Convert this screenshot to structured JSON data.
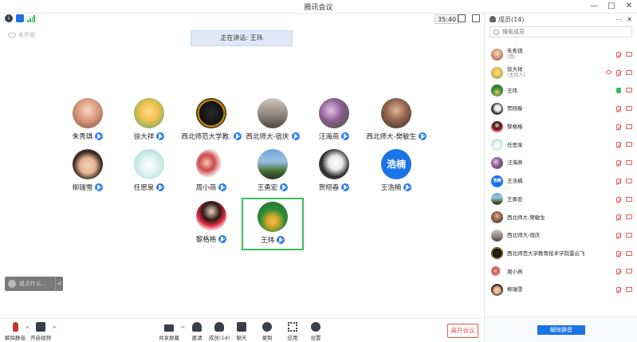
{
  "window": {
    "title": "腾讯会议",
    "controls": [
      "—",
      "□",
      "✕"
    ]
  },
  "info": {
    "timer": "35:40"
  },
  "stage": {
    "rec_tag": "未开始",
    "speaking": "正在讲话: 王玮",
    "tiles": [
      {
        "name": "朱秀琪"
      },
      {
        "name": "徐大祥"
      },
      {
        "name": "西北师范大学教..."
      },
      {
        "name": "西北师大-宿庆"
      },
      {
        "name": "汪海燕"
      },
      {
        "name": "西北师大-樊敏生"
      },
      {
        "name": "柳瑞雪"
      },
      {
        "name": "任思泉"
      },
      {
        "name": "周小燕"
      },
      {
        "name": "王勇宏"
      },
      {
        "name": "贺栩春"
      },
      {
        "name": "王浩楠",
        "avatar_text": "浩楠"
      },
      {
        "name": "黎格格"
      },
      {
        "name": "王玮"
      }
    ],
    "chat_placeholder": "说点什么...",
    "chat_arrow": "<"
  },
  "toolbar": {
    "mute": "解除静音",
    "video": "开启视频",
    "share": "共享屏幕",
    "invite": "邀请",
    "members": "成员(14)",
    "chat": "聊天",
    "record": "录制",
    "apps": "应用",
    "settings": "设置",
    "leave": "离开会议"
  },
  "panel": {
    "title": "成员(14)",
    "actions": [
      "⋯",
      "✕"
    ],
    "search_placeholder": "搜索成员",
    "members": [
      {
        "name": "朱秀琪",
        "tag": "(我)"
      },
      {
        "name": "徐大祥",
        "tag": "(主持人)"
      },
      {
        "name": "王玮",
        "tag": ""
      },
      {
        "name": "贺栩春",
        "tag": ""
      },
      {
        "name": "黎格格",
        "tag": ""
      },
      {
        "name": "任思泉",
        "tag": ""
      },
      {
        "name": "汪海燕",
        "tag": ""
      },
      {
        "name": "王浩楠",
        "tag": "",
        "avatar_text": "浩楠"
      },
      {
        "name": "王勇宏",
        "tag": ""
      },
      {
        "name": "西北师大-樊敏生",
        "tag": ""
      },
      {
        "name": "西北师大-宿庆",
        "tag": ""
      },
      {
        "name": "西北师范大学教育技术学院雷云飞",
        "tag": ""
      },
      {
        "name": "周小燕",
        "tag": ""
      },
      {
        "name": "柳瑞雪",
        "tag": ""
      }
    ],
    "unmute_all": "解除静音"
  }
}
